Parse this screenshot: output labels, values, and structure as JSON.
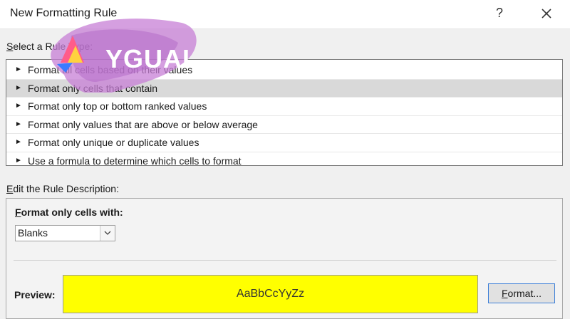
{
  "window": {
    "title": "New Formatting Rule",
    "help_symbol": "?"
  },
  "logo": {
    "text": "YGUAI"
  },
  "rule_type_section": {
    "label_first": "S",
    "label_rest": "elect a Rule Type:",
    "items": [
      {
        "label": "Format all cells based on their values",
        "selected": false
      },
      {
        "label": "Format only cells that contain",
        "selected": true
      },
      {
        "label": "Format only top or bottom ranked values",
        "selected": false
      },
      {
        "label": "Format only values that are above or below average",
        "selected": false
      },
      {
        "label": "Format only unique or duplicate values",
        "selected": false
      },
      {
        "label": "Use a formula to determine which cells to format",
        "selected": false
      }
    ]
  },
  "description_section": {
    "label_first": "E",
    "label_rest": "dit the Rule Description:",
    "format_only_first": "F",
    "format_only_rest": "ormat only cells with:",
    "condition_select": {
      "value": "Blanks"
    },
    "preview_label": "Preview:",
    "preview_text": "AaBbCcYyZz",
    "preview_fill": "#ffff00",
    "format_button_first": "F",
    "format_button_rest": "ormat..."
  }
}
